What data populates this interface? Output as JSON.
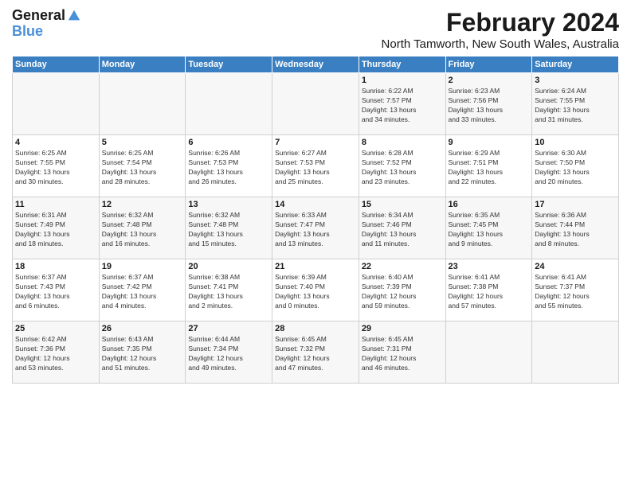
{
  "logo": {
    "general": "General",
    "blue": "Blue"
  },
  "title": {
    "month_year": "February 2024",
    "location": "North Tamworth, New South Wales, Australia"
  },
  "days_of_week": [
    "Sunday",
    "Monday",
    "Tuesday",
    "Wednesday",
    "Thursday",
    "Friday",
    "Saturday"
  ],
  "weeks": [
    [
      {
        "day": "",
        "info": ""
      },
      {
        "day": "",
        "info": ""
      },
      {
        "day": "",
        "info": ""
      },
      {
        "day": "",
        "info": ""
      },
      {
        "day": "1",
        "info": "Sunrise: 6:22 AM\nSunset: 7:57 PM\nDaylight: 13 hours\nand 34 minutes."
      },
      {
        "day": "2",
        "info": "Sunrise: 6:23 AM\nSunset: 7:56 PM\nDaylight: 13 hours\nand 33 minutes."
      },
      {
        "day": "3",
        "info": "Sunrise: 6:24 AM\nSunset: 7:55 PM\nDaylight: 13 hours\nand 31 minutes."
      }
    ],
    [
      {
        "day": "4",
        "info": "Sunrise: 6:25 AM\nSunset: 7:55 PM\nDaylight: 13 hours\nand 30 minutes."
      },
      {
        "day": "5",
        "info": "Sunrise: 6:25 AM\nSunset: 7:54 PM\nDaylight: 13 hours\nand 28 minutes."
      },
      {
        "day": "6",
        "info": "Sunrise: 6:26 AM\nSunset: 7:53 PM\nDaylight: 13 hours\nand 26 minutes."
      },
      {
        "day": "7",
        "info": "Sunrise: 6:27 AM\nSunset: 7:53 PM\nDaylight: 13 hours\nand 25 minutes."
      },
      {
        "day": "8",
        "info": "Sunrise: 6:28 AM\nSunset: 7:52 PM\nDaylight: 13 hours\nand 23 minutes."
      },
      {
        "day": "9",
        "info": "Sunrise: 6:29 AM\nSunset: 7:51 PM\nDaylight: 13 hours\nand 22 minutes."
      },
      {
        "day": "10",
        "info": "Sunrise: 6:30 AM\nSunset: 7:50 PM\nDaylight: 13 hours\nand 20 minutes."
      }
    ],
    [
      {
        "day": "11",
        "info": "Sunrise: 6:31 AM\nSunset: 7:49 PM\nDaylight: 13 hours\nand 18 minutes."
      },
      {
        "day": "12",
        "info": "Sunrise: 6:32 AM\nSunset: 7:48 PM\nDaylight: 13 hours\nand 16 minutes."
      },
      {
        "day": "13",
        "info": "Sunrise: 6:32 AM\nSunset: 7:48 PM\nDaylight: 13 hours\nand 15 minutes."
      },
      {
        "day": "14",
        "info": "Sunrise: 6:33 AM\nSunset: 7:47 PM\nDaylight: 13 hours\nand 13 minutes."
      },
      {
        "day": "15",
        "info": "Sunrise: 6:34 AM\nSunset: 7:46 PM\nDaylight: 13 hours\nand 11 minutes."
      },
      {
        "day": "16",
        "info": "Sunrise: 6:35 AM\nSunset: 7:45 PM\nDaylight: 13 hours\nand 9 minutes."
      },
      {
        "day": "17",
        "info": "Sunrise: 6:36 AM\nSunset: 7:44 PM\nDaylight: 13 hours\nand 8 minutes."
      }
    ],
    [
      {
        "day": "18",
        "info": "Sunrise: 6:37 AM\nSunset: 7:43 PM\nDaylight: 13 hours\nand 6 minutes."
      },
      {
        "day": "19",
        "info": "Sunrise: 6:37 AM\nSunset: 7:42 PM\nDaylight: 13 hours\nand 4 minutes."
      },
      {
        "day": "20",
        "info": "Sunrise: 6:38 AM\nSunset: 7:41 PM\nDaylight: 13 hours\nand 2 minutes."
      },
      {
        "day": "21",
        "info": "Sunrise: 6:39 AM\nSunset: 7:40 PM\nDaylight: 13 hours\nand 0 minutes."
      },
      {
        "day": "22",
        "info": "Sunrise: 6:40 AM\nSunset: 7:39 PM\nDaylight: 12 hours\nand 59 minutes."
      },
      {
        "day": "23",
        "info": "Sunrise: 6:41 AM\nSunset: 7:38 PM\nDaylight: 12 hours\nand 57 minutes."
      },
      {
        "day": "24",
        "info": "Sunrise: 6:41 AM\nSunset: 7:37 PM\nDaylight: 12 hours\nand 55 minutes."
      }
    ],
    [
      {
        "day": "25",
        "info": "Sunrise: 6:42 AM\nSunset: 7:36 PM\nDaylight: 12 hours\nand 53 minutes."
      },
      {
        "day": "26",
        "info": "Sunrise: 6:43 AM\nSunset: 7:35 PM\nDaylight: 12 hours\nand 51 minutes."
      },
      {
        "day": "27",
        "info": "Sunrise: 6:44 AM\nSunset: 7:34 PM\nDaylight: 12 hours\nand 49 minutes."
      },
      {
        "day": "28",
        "info": "Sunrise: 6:45 AM\nSunset: 7:32 PM\nDaylight: 12 hours\nand 47 minutes."
      },
      {
        "day": "29",
        "info": "Sunrise: 6:45 AM\nSunset: 7:31 PM\nDaylight: 12 hours\nand 46 minutes."
      },
      {
        "day": "",
        "info": ""
      },
      {
        "day": "",
        "info": ""
      }
    ]
  ]
}
